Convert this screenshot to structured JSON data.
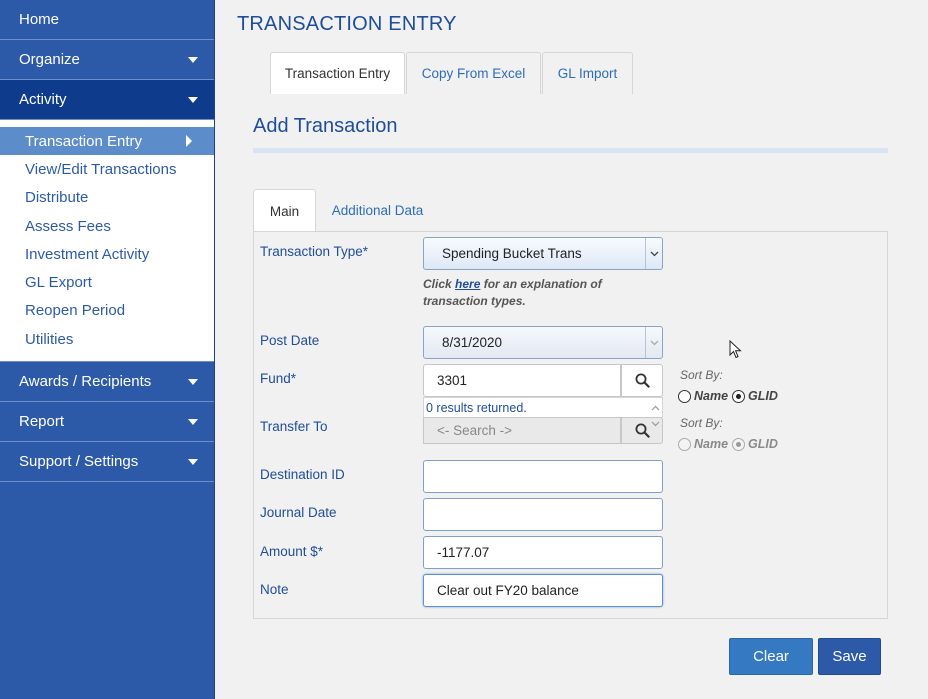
{
  "sidebar": {
    "home": "Home",
    "organize": "Organize",
    "activity": "Activity",
    "activity_items": [
      "Transaction Entry",
      "View/Edit Transactions",
      "Distribute",
      "Assess Fees",
      "Investment Activity",
      "GL Export",
      "Reopen Period",
      "Utilities"
    ],
    "awards": "Awards / Recipients",
    "report": "Report",
    "support": "Support / Settings"
  },
  "page": {
    "title": "TRANSACTION ENTRY",
    "tabs": [
      "Transaction Entry",
      "Copy From Excel",
      "GL Import"
    ],
    "section_title": "Add Transaction",
    "inner_tabs": [
      "Main",
      "Additional Data"
    ]
  },
  "form": {
    "transaction_type": {
      "label": "Transaction Type*",
      "value": "Spending Bucket Trans"
    },
    "help": {
      "prefix": "Click ",
      "link": "here",
      "suffix": " for an explanation of transaction types."
    },
    "post_date": {
      "label": "Post Date",
      "value": "8/31/2020"
    },
    "fund": {
      "label": "Fund*",
      "value": "3301",
      "results": "0 results returned."
    },
    "transfer_to": {
      "label": "Transfer To",
      "placeholder": "<- Search ->"
    },
    "destination_id": {
      "label": "Destination ID",
      "value": ""
    },
    "journal_date": {
      "label": "Journal Date",
      "value": ""
    },
    "amount": {
      "label": "Amount $*",
      "value": "-1177.07"
    },
    "note": {
      "label": "Note",
      "value": "Clear out FY20 balance"
    },
    "sort_by_label": "Sort By:",
    "sort_options": [
      "Name",
      "GLID"
    ]
  },
  "buttons": {
    "clear": "Clear",
    "save": "Save"
  }
}
